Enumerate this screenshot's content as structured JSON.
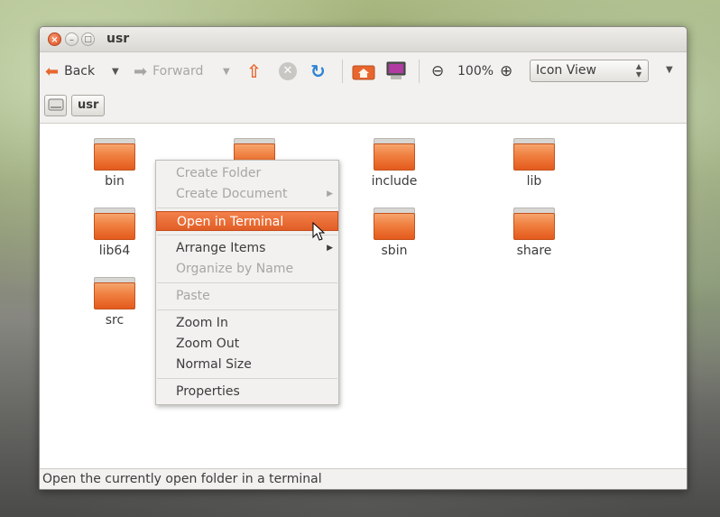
{
  "window": {
    "title": "usr"
  },
  "toolbar": {
    "back_label": "Back",
    "forward_label": "Forward",
    "zoom_level": "100%",
    "view_mode": "Icon View"
  },
  "pathbar": {
    "current": "usr"
  },
  "files": [
    {
      "name": "bin"
    },
    {
      "name": ""
    },
    {
      "name": "include"
    },
    {
      "name": "lib"
    },
    {
      "name": "lib64"
    },
    {
      "name": "sbin"
    },
    {
      "name": "share"
    },
    {
      "name": "src"
    }
  ],
  "context_menu": {
    "create_folder": "Create Folder",
    "create_document": "Create Document",
    "open_in_terminal": "Open in Terminal",
    "arrange_items": "Arrange Items",
    "organize_by_name": "Organize by Name",
    "paste": "Paste",
    "zoom_in": "Zoom In",
    "zoom_out": "Zoom Out",
    "normal_size": "Normal Size",
    "properties": "Properties"
  },
  "statusbar": {
    "text": "Open the currently open folder in a terminal"
  },
  "colors": {
    "accent": "#e8662e",
    "folder": "#ef7f3f"
  }
}
